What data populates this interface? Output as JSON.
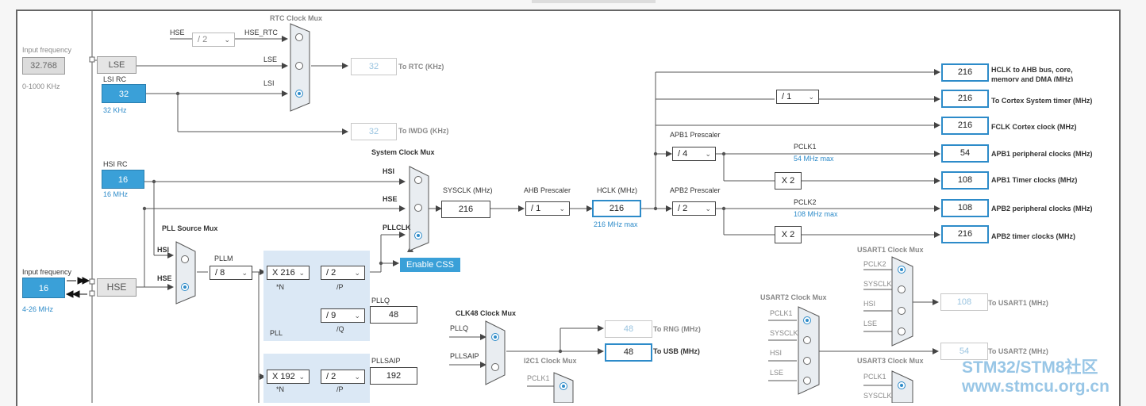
{
  "left_panel": {
    "lse_input_label": "Input frequency",
    "lse_input_value": "32.768",
    "lse_range": "0-1000 KHz",
    "hse_input_label": "Input frequency",
    "hse_input_value": "16",
    "hse_range": "4-26 MHz"
  },
  "sources": {
    "lse": "LSE",
    "lsi_label": "LSI RC",
    "lsi_value": "32",
    "lsi_freq": "32 KHz",
    "hsi_label": "HSI RC",
    "hsi_value": "16",
    "hsi_freq": "16 MHz",
    "hse": "HSE"
  },
  "rtc": {
    "title": "RTC Clock Mux",
    "hse_label": "HSE",
    "div": "/ 2",
    "hse_rtc": "HSE_RTC",
    "lse_label": "LSE",
    "lsi_label": "LSI",
    "rtc_value": "32",
    "rtc_dest": "To RTC (KHz)",
    "iwdg_value": "32",
    "iwdg_dest": "To IWDG (KHz)"
  },
  "system_mux": {
    "title": "System Clock Mux",
    "hsi": "HSI",
    "hse": "HSE",
    "pllclk": "PLLCLK",
    "enable_css": "Enable CSS"
  },
  "pll_source": {
    "title": "PLL Source Mux",
    "hsi": "HSI",
    "hse": "HSE"
  },
  "pll": {
    "pllm_label": "PLLM",
    "pllm": "/ 8",
    "n": "X 216",
    "n_label": "*N",
    "p": "/ 2",
    "p_label": "/P",
    "q": "/ 9",
    "q_label": "/Q",
    "pll_label": "PLL",
    "pllq_label": "PLLQ",
    "pllq_value": "48"
  },
  "pllsai": {
    "n": "X 192",
    "n_label": "*N",
    "p": "/ 2",
    "p_label": "/P",
    "pllsaip_label": "PLLSAIP",
    "pllsaip_value": "192"
  },
  "sysclk": {
    "label": "SYSCLK (MHz)",
    "value": "216",
    "ahb_label": "AHB Prescaler",
    "ahb": "/ 1",
    "hclk_label": "HCLK (MHz)",
    "hclk_value": "216",
    "hclk_max": "216 MHz max"
  },
  "outputs": {
    "hclk_ahb_value": "216",
    "hclk_ahb_label": "HCLK to AHB bus, core,",
    "hclk_ahb_label2": "memory and DMA (MHz)",
    "cortex_div": "/ 1",
    "cortex_value": "216",
    "cortex_label": "To Cortex System timer (MHz)",
    "fclk_value": "216",
    "fclk_label": "FCLK Cortex clock (MHz)",
    "apb1_prescaler_label": "APB1 Prescaler",
    "apb1_div": "/ 4",
    "pclk1_label": "PCLK1",
    "pclk1_max": "54 MHz max",
    "apb1_periph_value": "54",
    "apb1_periph_label": "APB1 peripheral clocks (MHz)",
    "apb1_timer_mult": "X 2",
    "apb1_timer_value": "108",
    "apb1_timer_label": "APB1 Timer clocks (MHz)",
    "apb2_prescaler_label": "APB2 Prescaler",
    "apb2_div": "/ 2",
    "pclk2_label": "PCLK2",
    "pclk2_max": "108 MHz max",
    "apb2_periph_value": "108",
    "apb2_periph_label": "APB2 peripheral clocks (MHz)",
    "apb2_timer_mult": "X 2",
    "apb2_timer_value": "216",
    "apb2_timer_label": "APB2 timer clocks (MHz)"
  },
  "clk48": {
    "title": "CLK48 Clock Mux",
    "pllq": "PLLQ",
    "pllsaip": "PLLSAIP",
    "rng_value": "48",
    "rng_label": "To RNG (MHz)",
    "usb_value": "48",
    "usb_label": "To USB (MHz)"
  },
  "i2c1": {
    "title": "I2C1 Clock Mux",
    "pclk1": "PCLK1"
  },
  "usart1": {
    "title": "USART1 Clock Mux",
    "pclk2": "PCLK2",
    "sysclk": "SYSCLK",
    "hsi": "HSI",
    "lse": "LSE",
    "value": "108",
    "dest": "To USART1 (MHz)"
  },
  "usart2": {
    "title": "USART2 Clock Mux",
    "pclk1": "PCLK1",
    "sysclk": "SYSCLK",
    "hsi": "HSI",
    "lse": "LSE",
    "value": "54",
    "dest": "To USART2 (MHz)"
  },
  "usart3": {
    "title": "USART3 Clock Mux",
    "pclk1": "PCLK1",
    "sysclk": "SYSCLK"
  },
  "watermark": {
    "line1": "STM32/STM8社区",
    "line2": "www.stmcu.org.cn"
  },
  "icons": {
    "chevron": "chevron-down-icon",
    "radio": "radio-icon"
  },
  "colors": {
    "accent": "#3aa0d8",
    "output_border": "#2d8bc9",
    "pll_bg": "#dbe8f5"
  }
}
